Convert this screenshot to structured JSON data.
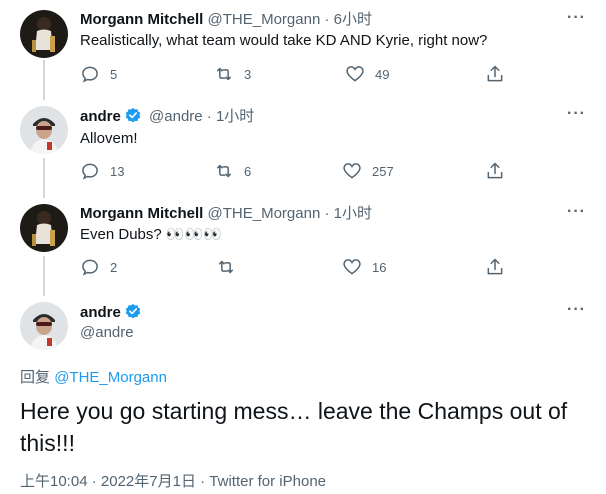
{
  "tweets": [
    {
      "name": "Morgann Mitchell",
      "handle": "@THE_Morgann",
      "dot": "·",
      "time": "6小时",
      "text": "Realistically, what team would take KD AND Kyrie, right now?",
      "verified": false,
      "avatar": "woman-photo-avatar",
      "replies": "5",
      "retweets": "3",
      "likes": "49"
    },
    {
      "name": "andre",
      "handle": "@andre",
      "dot": "·",
      "time": "1小时",
      "text": "Allovem!",
      "verified": true,
      "avatar": "man-cap-avatar",
      "replies": "13",
      "retweets": "6",
      "likes": "257"
    },
    {
      "name": "Morgann Mitchell",
      "handle": "@THE_Morgann",
      "dot": "·",
      "time": "1小时",
      "text": "Even Dubs? 👀👀👀",
      "verified": false,
      "avatar": "woman-photo-avatar",
      "replies": "2",
      "retweets": "",
      "likes": "16"
    }
  ],
  "main_tweet": {
    "name": "andre",
    "handle": "@andre",
    "verified": true,
    "replying_prefix": "回复",
    "replying_to": "@THE_Morgann",
    "text": "Here you go starting mess… leave the Champs out of this!!!",
    "time": "上午10:04",
    "date": "2022年7月1日",
    "dot": "·",
    "source": "Twitter for iPhone"
  },
  "more_label": "···",
  "colors": {
    "accent": "#1d9bf0",
    "secondary_text": "#536471",
    "thread_line": "#cfd9de"
  }
}
